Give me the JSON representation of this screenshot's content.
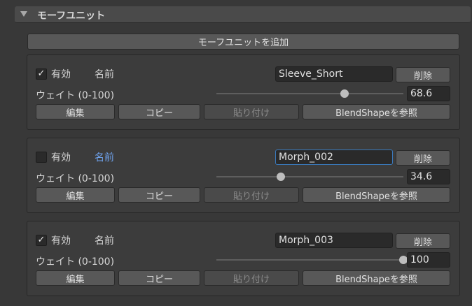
{
  "section": {
    "title": "モーフユニット"
  },
  "add_button": "モーフユニットを追加",
  "units": [
    {
      "enabled": true,
      "check_glyph": "✓",
      "enable_label": "有効",
      "name_label": "名前",
      "name_value": "Sleeve_Short",
      "delete_label": "削除",
      "weight_label": "ウェイト (0-100)",
      "weight_value": "68.6",
      "weight": 68.6,
      "edit_label": "編集",
      "copy_label": "コピー",
      "paste_label": "貼り付け",
      "blendshape_label": "BlendShapeを参照"
    },
    {
      "enabled": false,
      "check_glyph": "",
      "enable_label": "有効",
      "name_label": "名前",
      "name_value": "Morph_002",
      "delete_label": "削除",
      "weight_label": "ウェイト (0-100)",
      "weight_value": "34.6",
      "weight": 34.6,
      "edit_label": "編集",
      "copy_label": "コピー",
      "paste_label": "貼り付け",
      "blendshape_label": "BlendShapeを参照"
    },
    {
      "enabled": true,
      "check_glyph": "✓",
      "enable_label": "有効",
      "name_label": "名前",
      "name_value": "Morph_003",
      "delete_label": "削除",
      "weight_label": "ウェイト (0-100)",
      "weight_value": "100",
      "weight": 100,
      "edit_label": "編集",
      "copy_label": "コピー",
      "paste_label": "貼り付け",
      "blendshape_label": "BlendShapeを参照"
    }
  ],
  "colors": {
    "background": "#383838",
    "card": "#3c3c3c",
    "button": "#585858",
    "focus_border": "#3a79bb",
    "active_label": "#6fa3ee"
  }
}
